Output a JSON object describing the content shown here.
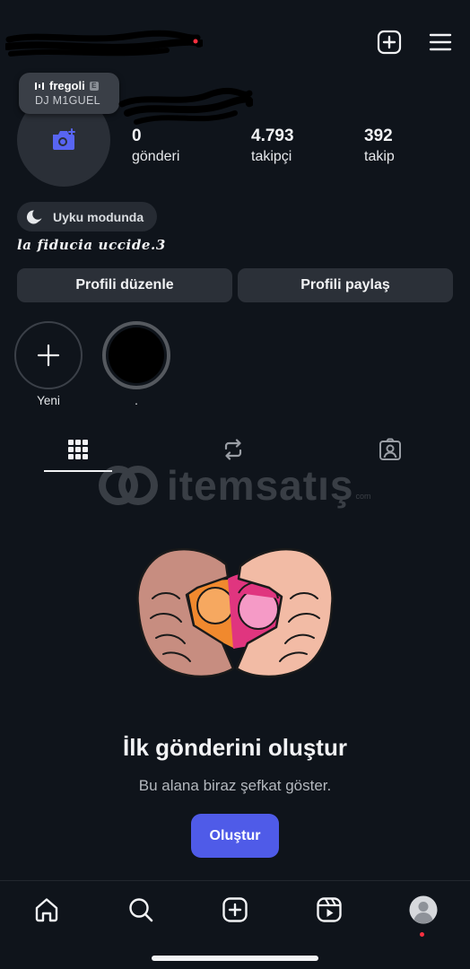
{
  "header": {
    "username_scribbled": true
  },
  "top_actions": {
    "create_icon": "plus-square-icon",
    "menu_icon": "hamburger-menu-icon"
  },
  "profile": {
    "avatar_icon": "add-photo-camera-icon",
    "music_note": {
      "song": "fregoli",
      "explicit": "E",
      "artist": "DJ M1GUEL"
    },
    "stats": [
      {
        "value": "0",
        "label": "gönderi"
      },
      {
        "value": "4.793",
        "label": "takipçi"
      },
      {
        "value": "392",
        "label": "takip"
      }
    ],
    "status_pill": {
      "icon": "moon-icon",
      "label": "Uyku modunda"
    },
    "bio": "la fiducia uccide.3"
  },
  "buttons": {
    "edit": "Profili düzenle",
    "share": "Profili paylaş"
  },
  "highlights": [
    {
      "label": "Yeni",
      "type": "new"
    },
    {
      "label": ".",
      "type": "story"
    }
  ],
  "tabs": [
    {
      "name": "grid",
      "icon": "grid-icon",
      "active": true
    },
    {
      "name": "reposts",
      "icon": "repost-icon",
      "active": false
    },
    {
      "name": "tagged",
      "icon": "tagged-person-icon",
      "active": false
    }
  ],
  "watermark": {
    "text": "itemsatış",
    "subtext": "com"
  },
  "empty_state": {
    "title": "İlk gönderini oluştur",
    "subtitle": "Bu alana biraz şefkat göster.",
    "button": "Oluştur"
  },
  "bottom_nav": [
    {
      "name": "home",
      "icon": "home-icon"
    },
    {
      "name": "search",
      "icon": "search-icon"
    },
    {
      "name": "create",
      "icon": "plus-square-icon"
    },
    {
      "name": "reels",
      "icon": "reels-icon"
    },
    {
      "name": "profile",
      "icon": "avatar-icon",
      "notification_dot": true
    }
  ],
  "colors": {
    "background": "#0f141b",
    "button": "#2b3038",
    "accent": "#4f5be8",
    "dot": "#ff3040"
  }
}
